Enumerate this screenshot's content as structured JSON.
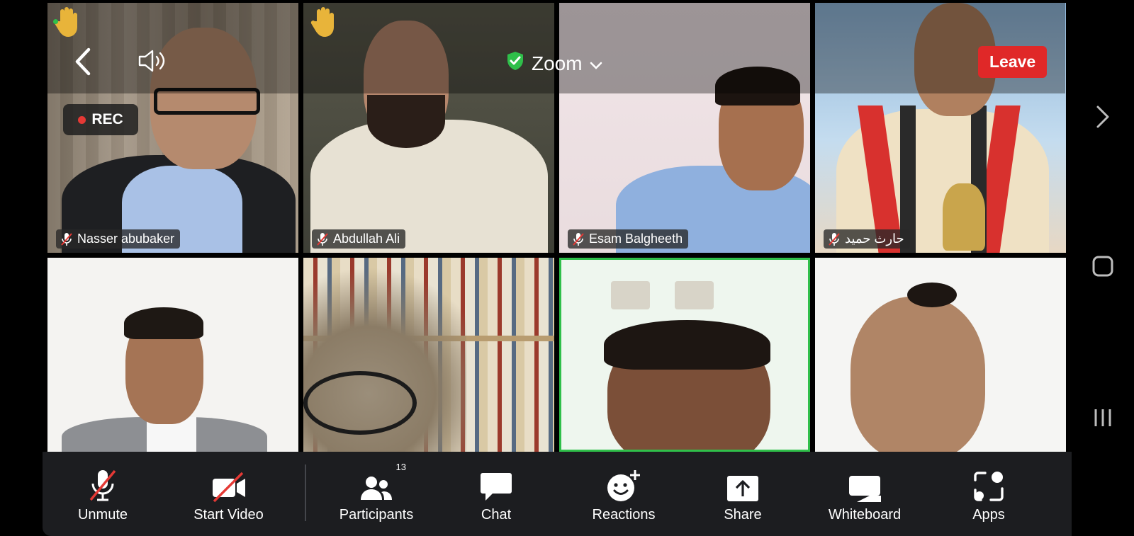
{
  "participants": [
    {
      "name": "Nasser abubaker"
    },
    {
      "name": "Abdullah Ali"
    },
    {
      "name": "Esam Balgheeth"
    },
    {
      "name": "حارث حميد"
    }
  ],
  "header": {
    "title": "Zoom",
    "recording_label": "REC",
    "leave_label": "Leave"
  },
  "toolbar": {
    "unmute_label": "Unmute",
    "start_video_label": "Start Video",
    "participants_label": "Participants",
    "participants_count": "13",
    "chat_label": "Chat",
    "reactions_label": "Reactions",
    "share_label": "Share",
    "whiteboard_label": "Whiteboard",
    "apps_label": "Apps"
  },
  "icons": {
    "back": "chevron-left-icon",
    "speaker": "speaker-icon",
    "shield": "shield-check-icon",
    "dropdown": "chevron-down-icon",
    "hand": "raised-hand-icon",
    "muted_mic": "mic-off-icon",
    "nav_forward": "chevron-right-icon",
    "nav_home": "square-icon",
    "nav_recents": "recents-icon"
  },
  "colors": {
    "leave": "#e02828",
    "active_speaker_border": "#2fbf4a",
    "toolbar_bg": "#1c1d20",
    "rec_dot": "#e53935",
    "shield": "#2fbf4a",
    "hand": "#e8b43a"
  }
}
